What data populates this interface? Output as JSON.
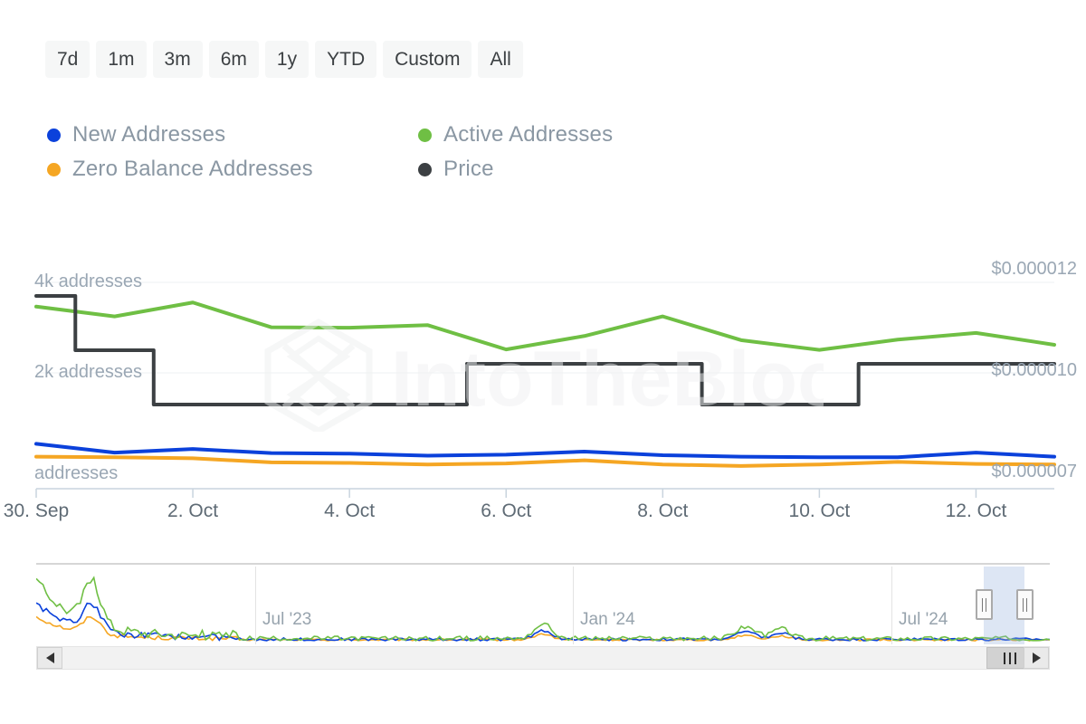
{
  "range_selector": {
    "buttons": [
      {
        "label": "7d",
        "selected": false
      },
      {
        "label": "1m",
        "selected": false
      },
      {
        "label": "3m",
        "selected": false
      },
      {
        "label": "6m",
        "selected": false
      },
      {
        "label": "1y",
        "selected": false
      },
      {
        "label": "YTD",
        "selected": false
      },
      {
        "label": "Custom",
        "selected": false
      },
      {
        "label": "All",
        "selected": false
      }
    ]
  },
  "legend": {
    "items": [
      {
        "label": "New Addresses",
        "color": "#0b41db",
        "icon": "legend-dot-icon"
      },
      {
        "label": "Active Addresses",
        "color": "#6fbf44",
        "icon": "legend-dot-icon"
      },
      {
        "label": "Zero Balance Addresses",
        "color": "#f5a623",
        "icon": "legend-dot-icon"
      },
      {
        "label": "Price",
        "color": "#3c4043",
        "icon": "legend-dot-icon"
      }
    ]
  },
  "watermark": {
    "text": "IntoTheBlock"
  },
  "navigator": {
    "date_labels": [
      "Jul '23",
      "Jan '24",
      "Jul '24"
    ],
    "selection_start_pct": 93.5,
    "selection_end_pct": 97.5,
    "scroll_left_icon": "triangle-left-icon",
    "scroll_right_icon": "triangle-right-icon",
    "grip_icon": "grip-vertical-icon"
  },
  "chart_data": {
    "type": "line",
    "title": "",
    "xlabel": "",
    "ylabel": "addresses",
    "y2label": "",
    "grid": true,
    "legend_position": "top-left",
    "x": [
      "30. Sep",
      "1. Oct",
      "2. Oct",
      "3. Oct",
      "4. Oct",
      "5. Oct",
      "6. Oct",
      "7. Oct",
      "8. Oct",
      "9. Oct",
      "10. Oct",
      "11. Oct",
      "12. Oct",
      "13. Oct"
    ],
    "xtick_labels": [
      "30. Sep",
      "2. Oct",
      "4. Oct",
      "6. Oct",
      "8. Oct",
      "10. Oct",
      "12. Oct"
    ],
    "yaxis_left": {
      "tick_labels": [
        "4k addresses",
        "2k addresses",
        "addresses"
      ],
      "tick_values": [
        4000,
        2000,
        0
      ],
      "ylim": [
        0,
        4600
      ]
    },
    "yaxis_right": {
      "tick_labels": [
        "$0.000012",
        "$0.000010",
        "$0.000007"
      ],
      "tick_values": [
        1.2e-05,
        1e-05,
        7e-06
      ],
      "ylim": [
        6.2e-06,
        1.26e-05
      ]
    },
    "series": [
      {
        "name": "Active Addresses",
        "color": "#6fbf44",
        "axis": "left",
        "step": false,
        "values": [
          3530,
          3340,
          3610,
          3130,
          3120,
          3170,
          2700,
          2960,
          3340,
          2880,
          2690,
          2890,
          3020,
          2790
        ]
      },
      {
        "name": "New Addresses",
        "color": "#0b41db",
        "axis": "left",
        "step": false,
        "values": [
          870,
          700,
          770,
          690,
          680,
          640,
          660,
          720,
          650,
          620,
          610,
          610,
          700,
          620
        ]
      },
      {
        "name": "Zero Balance Addresses",
        "color": "#f5a623",
        "axis": "left",
        "step": false,
        "values": [
          620,
          610,
          590,
          510,
          500,
          470,
          490,
          550,
          470,
          440,
          470,
          520,
          480,
          470
        ]
      },
      {
        "name": "Price",
        "color": "#3c4043",
        "axis": "right",
        "step": true,
        "values": [
          1.17e-05,
          1.05e-05,
          9.3e-06,
          9.3e-06,
          9.3e-06,
          9.3e-06,
          1.02e-05,
          1.02e-05,
          1.02e-05,
          9.3e-06,
          9.3e-06,
          1.02e-05,
          1.02e-05,
          1.02e-05
        ]
      }
    ]
  }
}
